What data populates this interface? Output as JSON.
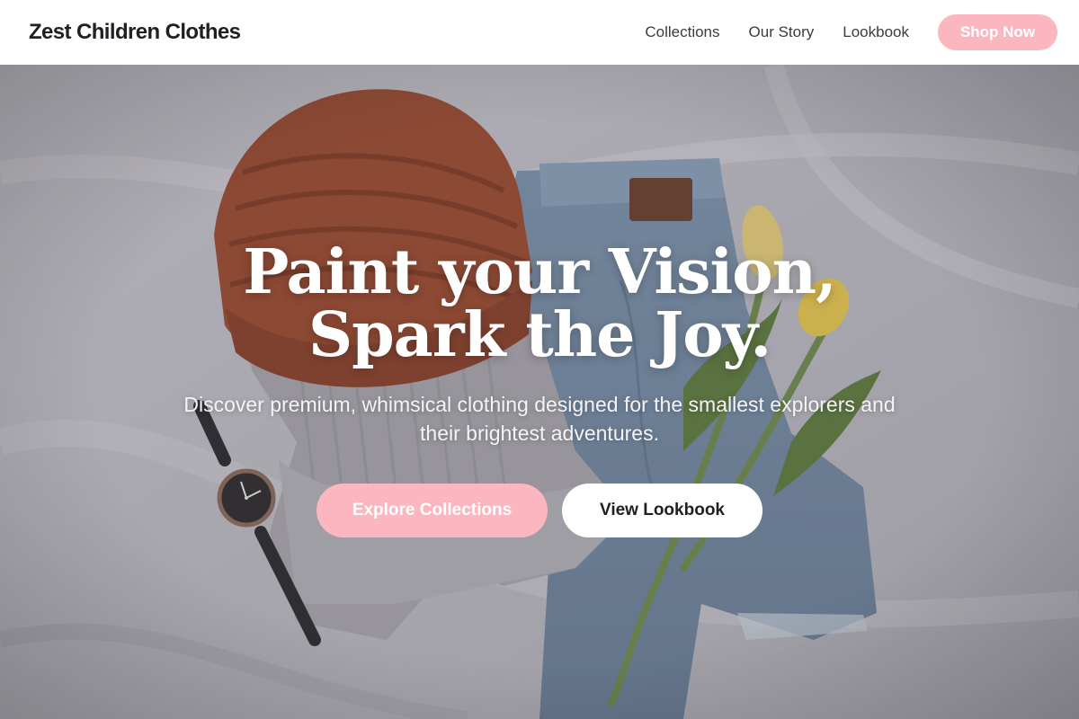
{
  "nav": {
    "brand": "Zest Children Clothes",
    "links": [
      "Collections",
      "Our Story",
      "Lookbook"
    ],
    "cta": "Shop Now"
  },
  "hero": {
    "title": "Paint your Vision, Spark the Joy.",
    "subtitle": "Discover premium, whimsical clothing designed for the smallest explorers and their brightest adventures.",
    "primary_button": "Explore Collections",
    "secondary_button": "View Lookbook"
  },
  "colors": {
    "accent_pink": "#fbb6c0",
    "text_dark": "#1f1f24",
    "white": "#ffffff"
  }
}
